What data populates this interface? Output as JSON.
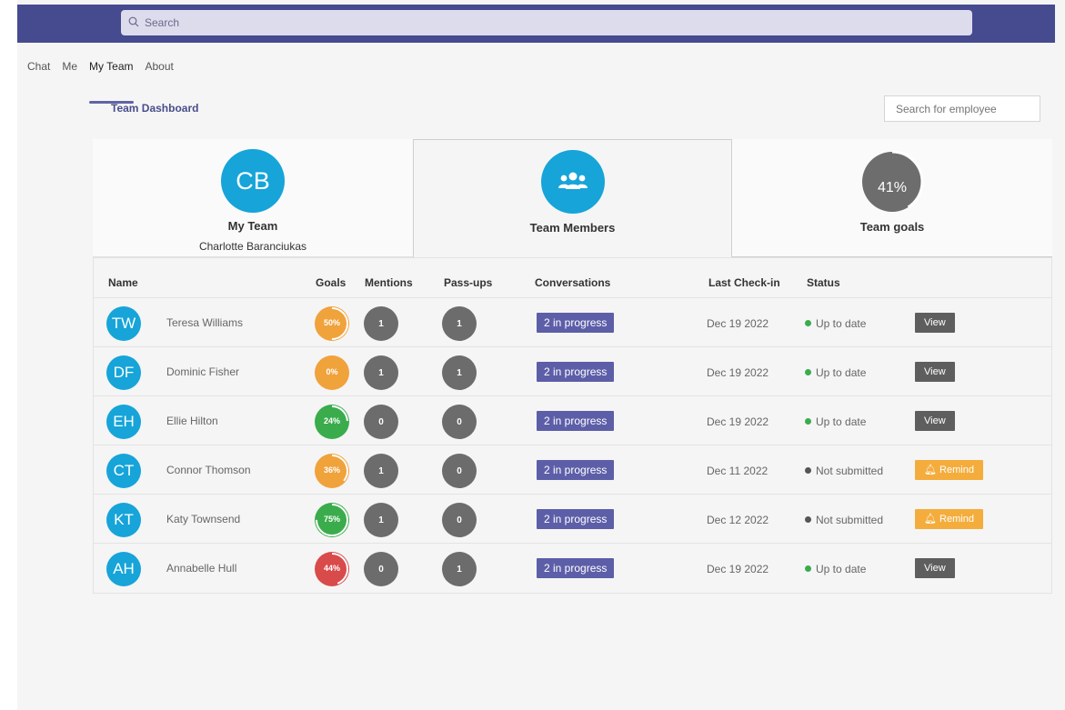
{
  "topbar": {
    "search_placeholder": "Search",
    "search_icon": "search-icon"
  },
  "tabs": [
    "Chat",
    "Me",
    "My Team",
    "About"
  ],
  "active_tab": "My Team",
  "dashboard": {
    "title": "Team Dashboard",
    "employee_search_placeholder": "Search for employee"
  },
  "cards": {
    "my_team": {
      "initials": "CB",
      "title": "My Team",
      "subtitle": "Charlotte Baranciukas"
    },
    "team_members": {
      "title": "Team Members",
      "icon": "people-group-icon"
    },
    "team_goals": {
      "percent_label": "41%",
      "percent": 41,
      "title": "Team goals"
    }
  },
  "colors": {
    "accent": "#6264a7",
    "avatar": "#16a4d9",
    "goal_orange": "#f0a23b",
    "goal_green": "#3aac4c",
    "goal_red": "#d94a4a",
    "remind": "#f4ad3d",
    "status_green": "#3aac4c",
    "status_grey": "#555555"
  },
  "table": {
    "headers": {
      "name": "Name",
      "goals": "Goals",
      "mentions": "Mentions",
      "passups": "Pass-ups",
      "conversations": "Conversations",
      "checkin": "Last Check-in",
      "status": "Status"
    },
    "rows": [
      {
        "initials": "TW",
        "name": "Teresa Williams",
        "goal_label": "50%",
        "goal": 50,
        "goal_color": "orange",
        "mentions": "1",
        "passups": "1",
        "conversations": "2 in progress",
        "checkin": "Dec 19 2022",
        "status": "Up to date",
        "status_kind": "ok",
        "action": "View"
      },
      {
        "initials": "DF",
        "name": "Dominic Fisher",
        "goal_label": "0%",
        "goal": 0,
        "goal_color": "orange",
        "mentions": "1",
        "passups": "1",
        "conversations": "2 in progress",
        "checkin": "Dec 19 2022",
        "status": "Up to date",
        "status_kind": "ok",
        "action": "View"
      },
      {
        "initials": "EH",
        "name": "Ellie Hilton",
        "goal_label": "24%",
        "goal": 24,
        "goal_color": "green",
        "mentions": "0",
        "passups": "0",
        "conversations": "2 in progress",
        "checkin": "Dec 19 2022",
        "status": "Up to date",
        "status_kind": "ok",
        "action": "View"
      },
      {
        "initials": "CT",
        "name": "Connor Thomson",
        "goal_label": "36%",
        "goal": 36,
        "goal_color": "orange",
        "mentions": "1",
        "passups": "0",
        "conversations": "2 in progress",
        "checkin": "Dec 11 2022",
        "status": "Not submitted",
        "status_kind": "missing",
        "action": "Remind"
      },
      {
        "initials": "KT",
        "name": "Katy Townsend",
        "goal_label": "75%",
        "goal": 75,
        "goal_color": "green",
        "mentions": "1",
        "passups": "0",
        "conversations": "2 in progress",
        "checkin": "Dec 12 2022",
        "status": "Not submitted",
        "status_kind": "missing",
        "action": "Remind"
      },
      {
        "initials": "AH",
        "name": "Annabelle Hull",
        "goal_label": "44%",
        "goal": 44,
        "goal_color": "red",
        "mentions": "0",
        "passups": "1",
        "conversations": "2 in progress",
        "checkin": "Dec 19 2022",
        "status": "Up to date",
        "status_kind": "ok",
        "action": "View"
      }
    ]
  }
}
